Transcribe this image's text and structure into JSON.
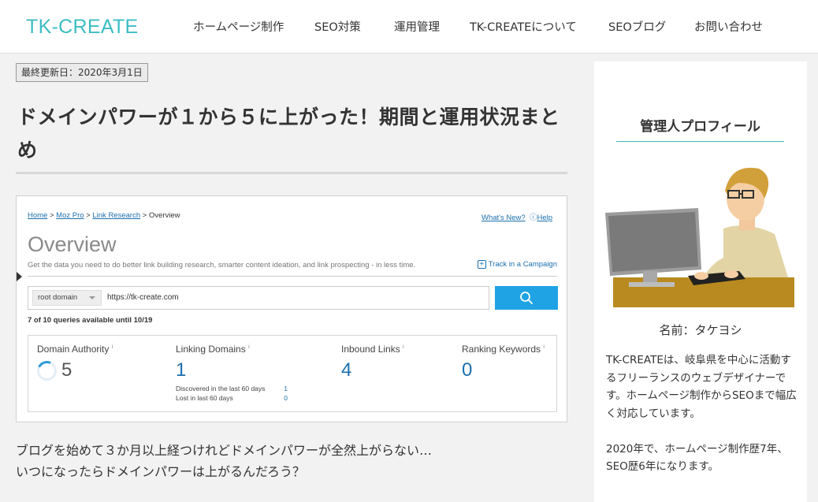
{
  "header": {
    "logo": "TK-CREATE",
    "nav": [
      "ホームページ制作",
      "SEO対策",
      "運用管理",
      "TK-CREATEについて",
      "SEOブログ",
      "お問い合わせ"
    ]
  },
  "article": {
    "updated": "最終更新日：2020年3月1日",
    "title": "ドメインパワーが１から５に上がった！期間と運用状況まとめ",
    "intro_lines": [
      "ブログを始めて３か月以上経つけれどドメインパワーが全然上がらない…",
      "いつになったらドメインパワーは上がるんだろう？"
    ]
  },
  "moz": {
    "breadcrumb": [
      "Home",
      "Moz Pro",
      "Link Research",
      "Overview"
    ],
    "whats_new": "What's New?",
    "help": "Help",
    "title": "Overview",
    "subtitle": "Get the data you need to do better link building research, smarter content ideation, and link prospecting - in less time.",
    "track": "Track in a Campaign",
    "select": "root domain",
    "url": "https://tk-create.com",
    "queries": "7 of 10 queries available until 10/19",
    "metrics": [
      {
        "label": "Domain Authority",
        "value": "5"
      },
      {
        "label": "Linking Domains",
        "value": "1"
      },
      {
        "label": "Inbound Links",
        "value": "4"
      },
      {
        "label": "Ranking Keywords",
        "value": "0"
      }
    ],
    "linking_details": [
      {
        "label": "Discovered in the last 60 days",
        "value": "1"
      },
      {
        "label": "Lost in last 60 days",
        "value": "0"
      }
    ],
    "info_mark": "i"
  },
  "sidebar": {
    "title": "管理人プロフィール",
    "name": "名前：タケヨシ",
    "bio": [
      "TK-CREATEは、岐阜県を中心に活動するフリーランスのウェブデザイナーです。ホームページ制作からSEOまで幅広く対応しています。",
      "2020年で、ホームページ制作歴7年、SEO歴6年になります。"
    ]
  },
  "colors": {
    "brand": "#3cbdc4",
    "moz_blue": "#1b6fae",
    "search_button": "#1fa3e4"
  }
}
